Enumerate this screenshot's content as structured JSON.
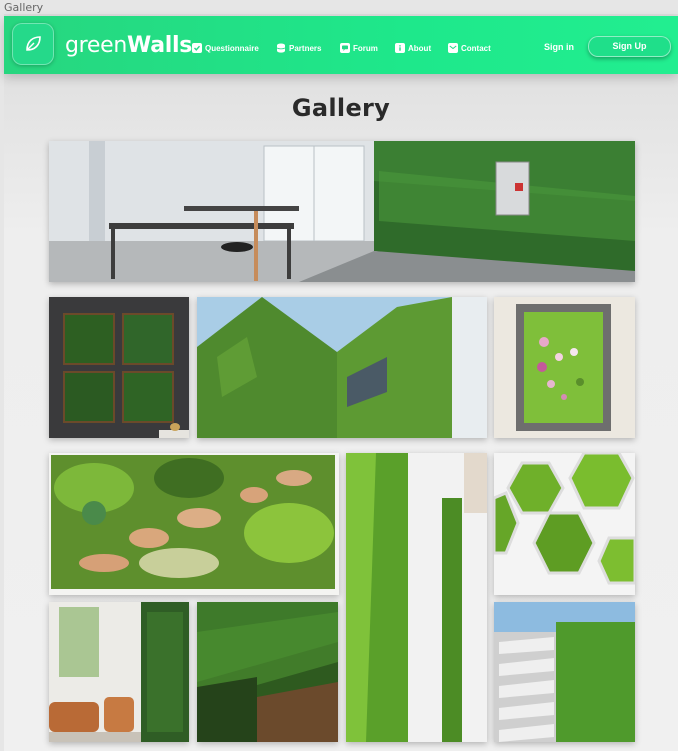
{
  "window": {
    "tab_title": "Gallery"
  },
  "brand": {
    "name_light": "green",
    "name_bold": "Walls",
    "logo_icon": "leaf-icon"
  },
  "nav": {
    "items": [
      {
        "label": "Questionnaire",
        "icon": "check-square-icon"
      },
      {
        "label": "Partners",
        "icon": "database-icon"
      },
      {
        "label": "Forum",
        "icon": "chat-icon"
      },
      {
        "label": "About",
        "icon": "info-icon"
      },
      {
        "label": "Contact",
        "icon": "envelope-icon"
      }
    ],
    "sign_in": "Sign in",
    "sign_up": "Sign Up"
  },
  "page": {
    "heading": "Gallery"
  },
  "colors": {
    "accent": "#22e68c",
    "heading": "#2a2a2a"
  }
}
